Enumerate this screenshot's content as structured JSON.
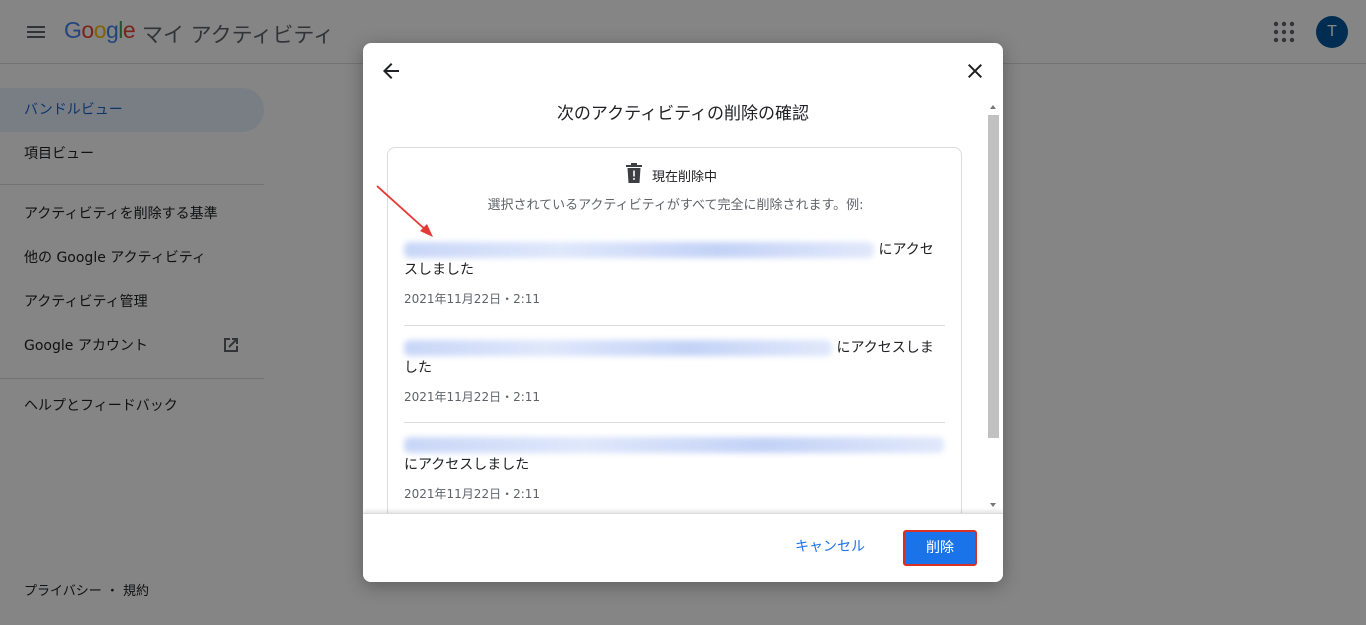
{
  "header": {
    "logo": [
      "G",
      "o",
      "o",
      "g",
      "l",
      "e"
    ],
    "app_title": "マイ アクティビティ",
    "avatar_initial": "T"
  },
  "sidebar": {
    "items": [
      {
        "label": "バンドルビュー",
        "active": true
      },
      {
        "label": "項目ビュー",
        "active": false
      },
      {
        "label": "アクティビティを削除する基準",
        "active": false
      },
      {
        "label": "他の Google アクティビティ",
        "active": false
      },
      {
        "label": "アクティビティ管理",
        "active": false
      },
      {
        "label": "Google アカウント",
        "active": false
      },
      {
        "label": "ヘルプとフィードバック",
        "active": false
      }
    ],
    "footer": "プライバシー ・ 規約"
  },
  "dialog": {
    "title": "次のアクティビティの削除の確認",
    "status_label": "現在削除中",
    "description": "選択されているアクティビティがすべて完全に削除されます。例:",
    "entries": [
      {
        "text_suffix": "にアクセ",
        "text_line2": "スしました",
        "date": "2021年11月22日・2:11"
      },
      {
        "text_suffix": "にアクセスしま",
        "text_line2": "した",
        "date": "2021年11月22日・2:11"
      },
      {
        "text_suffix": "",
        "text_line2": "にアクセスしました",
        "date": "2021年11月22日・2:11"
      }
    ],
    "cancel_label": "キャンセル",
    "delete_label": "削除"
  },
  "colors": {
    "accent": "#1a73e8",
    "avatar": "#01579b",
    "highlight_border": "#d93025",
    "annotation_arrow": "#e53935"
  }
}
